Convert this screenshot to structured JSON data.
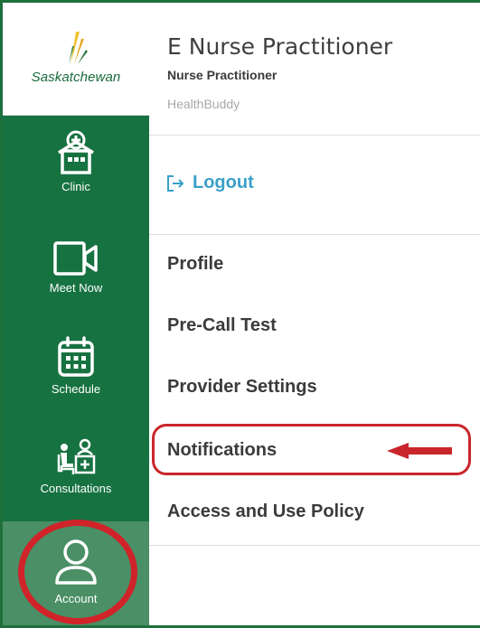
{
  "sidebar": {
    "logo_text": "Saskatchewan",
    "items": [
      {
        "label": "Clinic",
        "icon": "clinic-icon"
      },
      {
        "label": "Meet Now",
        "icon": "video-camera-icon"
      },
      {
        "label": "Schedule",
        "icon": "calendar-icon"
      },
      {
        "label": "Consultations",
        "icon": "consultations-icon"
      },
      {
        "label": "Account",
        "icon": "user-icon",
        "active": true
      }
    ]
  },
  "user": {
    "name": "E Nurse Practitioner",
    "role": "Nurse Practitioner",
    "app": "HealthBuddy"
  },
  "logout": {
    "label": "Logout",
    "icon": "logout-icon"
  },
  "menu": [
    "Profile",
    "Pre-Call Test",
    "Provider Settings",
    "Notifications",
    "Access and Use Policy"
  ],
  "colors": {
    "sidebar_bg": "#177241",
    "active_item_bg": "#4a8f65",
    "logout_text": "#3aa0c9",
    "annotation_red": "#c9262c"
  }
}
